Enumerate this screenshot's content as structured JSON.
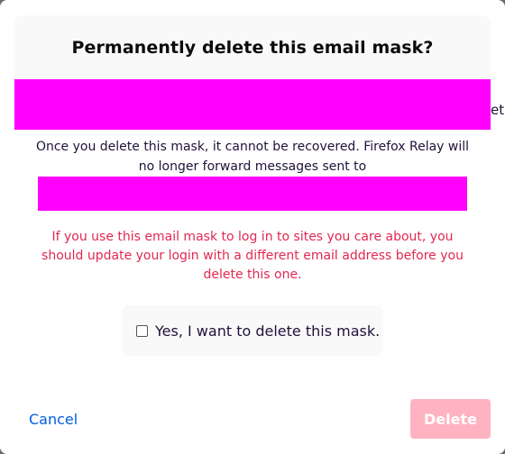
{
  "background": {
    "fragment": "• ••••• •••••• • ••••••••••• •••"
  },
  "dialog": {
    "title": "Permanently delete this email mask?",
    "side_clip": "et",
    "description": "Once you delete this mask, it cannot be recovered. Firefox Relay will no longer forward messages sent to",
    "warning": "If you use this email mask to log in to sites you care about, you should update your login with a different email address before you delete this one.",
    "confirm_label": "Yes, I want to delete this mask.",
    "confirm_checked": false,
    "cancel_label": "Cancel",
    "delete_label": "Delete"
  },
  "colors": {
    "redaction": "#ff00ff",
    "warning": "#e22850",
    "link": "#0060df",
    "delete_disabled": "#ffb3c0"
  }
}
